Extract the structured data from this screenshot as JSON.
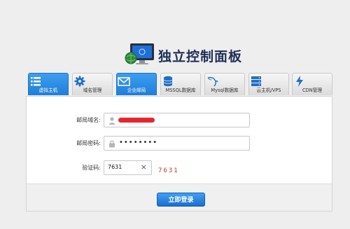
{
  "header": {
    "title": "独立控制面板"
  },
  "tabs": [
    {
      "label": "虚拟主机",
      "icon": "list-icon",
      "active": true
    },
    {
      "label": "域名管理",
      "icon": "gear-icon",
      "active": false
    },
    {
      "label": "企业邮局",
      "icon": "envelope-icon",
      "active": true
    },
    {
      "label": "MSSQL数据库",
      "icon": "database-icon",
      "active": false
    },
    {
      "label": "Mysql数据库",
      "icon": "dolphin-icon",
      "active": false
    },
    {
      "label": "云主机/VPS",
      "icon": "server-icon",
      "active": false
    },
    {
      "label": "CDN管理",
      "icon": "lightning-icon",
      "active": false
    }
  ],
  "form": {
    "domain_label": "邮局域名:",
    "password_label": "邮局密码:",
    "password_mask": "••••••••",
    "captcha_label": "验证码:",
    "captcha_value": "7631",
    "captcha_image_text": "7631",
    "clear_symbol": "×",
    "submit_label": "立即登录"
  },
  "colors": {
    "accent": "#1f7fd8",
    "title": "#1c2f55",
    "captcha": "#c0392b"
  }
}
